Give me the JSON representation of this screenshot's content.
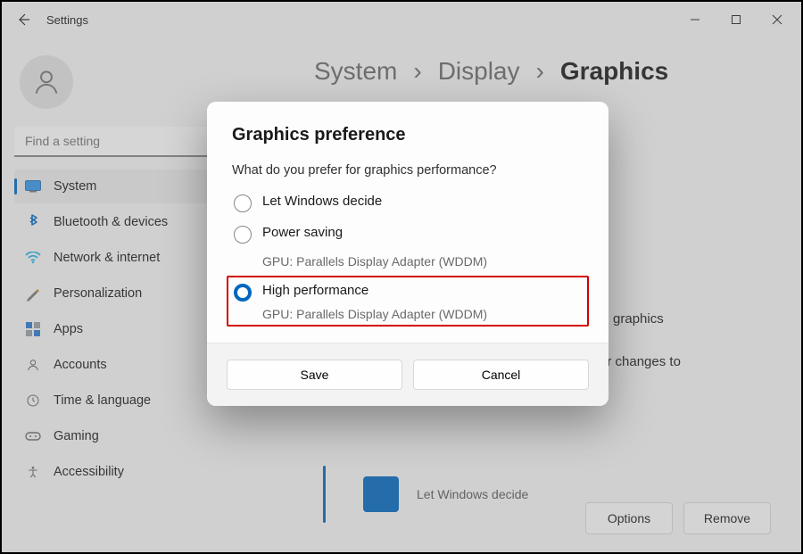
{
  "window": {
    "title": "Settings"
  },
  "search": {
    "placeholder": "Find a setting"
  },
  "sidebar": {
    "items": [
      {
        "label": "System",
        "selected": true,
        "color": "#0067c0"
      },
      {
        "label": "Bluetooth & devices",
        "color": "#0067c0"
      },
      {
        "label": "Network & internet",
        "color": "#00a2ed"
      },
      {
        "label": "Personalization",
        "color": "#6b6b6b"
      },
      {
        "label": "Apps",
        "color": "#0067c0"
      },
      {
        "label": "Accounts",
        "color": "#6b6b6b"
      },
      {
        "label": "Time & language",
        "color": "#6b6b6b"
      },
      {
        "label": "Gaming",
        "color": "#6b6b6b"
      },
      {
        "label": "Accessibility",
        "color": "#6b6b6b"
      }
    ]
  },
  "breadcrumbs": {
    "parts": [
      "System",
      "Display",
      "Graphics"
    ]
  },
  "background": {
    "fragment1": "e custom graphics",
    "fragment2": "p for your changes to",
    "app_row_label": "Let Windows decide",
    "options_label": "Options",
    "remove_label": "Remove"
  },
  "dialog": {
    "title": "Graphics preference",
    "question": "What do you prefer for graphics performance?",
    "options": [
      {
        "label": "Let Windows decide",
        "sub": "",
        "checked": false
      },
      {
        "label": "Power saving",
        "sub": "GPU: Parallels Display Adapter (WDDM)",
        "checked": false
      },
      {
        "label": "High performance",
        "sub": "GPU: Parallels Display Adapter (WDDM)",
        "checked": true
      }
    ],
    "save_label": "Save",
    "cancel_label": "Cancel"
  }
}
